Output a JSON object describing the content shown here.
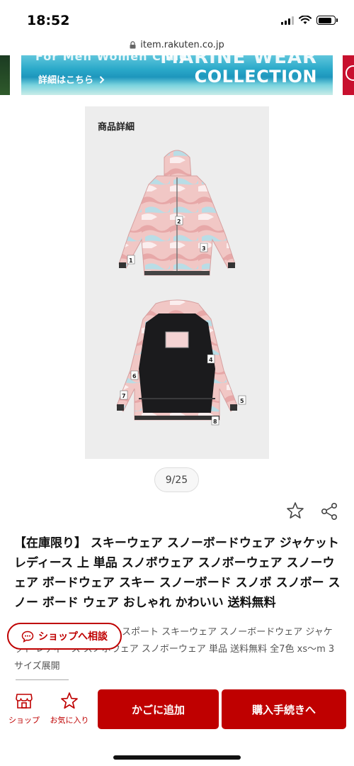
{
  "status_bar": {
    "time": "18:52"
  },
  "browser": {
    "url": "item.rakuten.co.jp"
  },
  "banner": {
    "top_text": "For Men Women Child",
    "headline_line1": "MARINE WEAR",
    "headline_line2": "COLLECTION",
    "link_text": "詳細はこちら"
  },
  "product_image": {
    "panel_title": "商品詳細",
    "front_markers": [
      "1",
      "2",
      "3"
    ],
    "inside_markers": [
      "4",
      "5",
      "6",
      "7",
      "8"
    ],
    "counter": "9/25"
  },
  "product": {
    "title": "【在庫限り】 スキーウェア スノーボードウェア ジャケット レディース 上 単品 スノボウェア スノボーウェア スノーウェア ボードウェア スキー スノーボード スノボ スノボー スノー ボード ウェア おしゃれ かわいい 送料無料",
    "description": "スポート スキーウェア スノーボードウェア ジャケット レディース スノボウェア スノボーウェア 単品 送料無料 全7色 xs〜m 3サイズ展開"
  },
  "consult_button": {
    "label": "ショップへ相談"
  },
  "bottom_nav": {
    "shop_label": "ショップ",
    "favorite_label": "お気に入り",
    "cart_button": "かごに追加",
    "buy_button": "購入手続きへ"
  },
  "colors": {
    "brand_red": "#bf0000",
    "panel_bg": "#ededed"
  }
}
